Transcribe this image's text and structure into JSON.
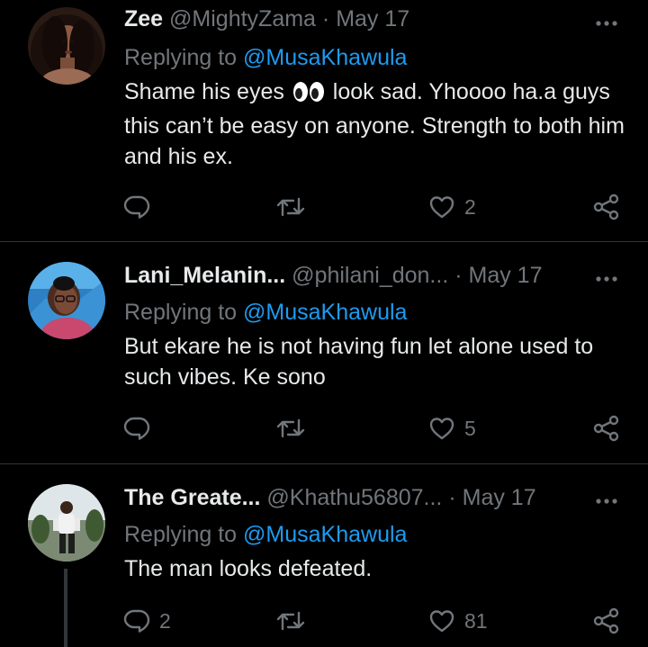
{
  "tweets": [
    {
      "name": "Zee",
      "handle": "@MightyZama",
      "separator": "·",
      "date": "May 17",
      "replying_prefix": "Replying to",
      "replying_to": "@MusaKhawula",
      "text_before_emoji": "Shame his eyes",
      "emoji": "eyes-emoji",
      "text_after_emoji": " look sad. Yhoooo ha.a guys this can’t be easy on anyone. Strength to both him and his ex.",
      "reply_count": "",
      "retweet_count": "",
      "like_count": "2"
    },
    {
      "name": "Lani_Melanin...",
      "handle": "@philani_don...",
      "separator": "·",
      "date": "May 17",
      "replying_prefix": "Replying to",
      "replying_to": "@MusaKhawula",
      "text": "But ekare he is not having fun let alone used to such vibes. Ke sono",
      "reply_count": "",
      "retweet_count": "",
      "like_count": "5"
    },
    {
      "name": "The Greate...",
      "handle": "@Khathu56807...",
      "separator": "·",
      "date": "May 17",
      "replying_prefix": "Replying to",
      "replying_to": "@MusaKhawula",
      "text": "The man looks defeated.",
      "reply_count": "2",
      "retweet_count": "",
      "like_count": "81"
    }
  ],
  "icons": {
    "reply": "reply-icon",
    "retweet": "retweet-icon",
    "like": "heart-icon",
    "share": "share-icon",
    "more": "more-icon"
  },
  "colors": {
    "background": "#000000",
    "text": "#e7e9ea",
    "muted": "#71767b",
    "mention": "#1d9bf0",
    "divider": "#2f3336"
  }
}
